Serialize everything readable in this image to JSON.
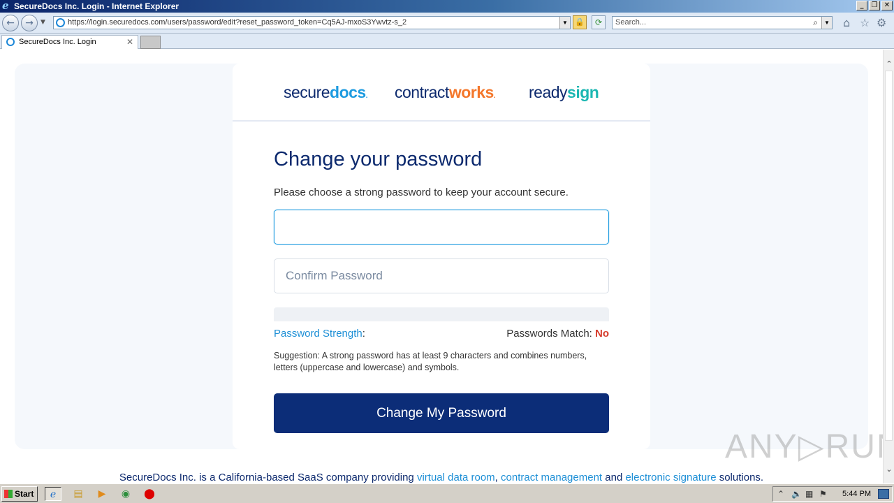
{
  "window": {
    "title": "SecureDocs Inc. Login - Internet Explorer",
    "address_url": "https://login.securedocs.com/users/password/edit?reset_password_token=Cq5AJ-mxoS3Ywvtz-s_2",
    "search_placeholder": "Search...",
    "tab_title": "SecureDocs Inc. Login"
  },
  "brands": {
    "securedocs_a": "secure",
    "securedocs_b": "docs",
    "contractworks_a": "contract",
    "contractworks_b": "works",
    "readysign_a": "ready",
    "readysign_b": "sign",
    "dot": "."
  },
  "form": {
    "heading": "Change your password",
    "subtext": "Please choose a strong password to keep your account secure.",
    "password_value": "",
    "confirm_placeholder": "Confirm Password",
    "strength_label": "Password Strength",
    "strength_colon": ":",
    "match_label": "Passwords Match: ",
    "match_value": "No",
    "suggestion": "Suggestion: A strong password has at least 9 characters and combines numbers, letters (uppercase and lowercase) and symbols.",
    "submit_label": "Change My Password"
  },
  "footer": {
    "prefix": "SecureDocs Inc. is a California-based SaaS company providing ",
    "link1": "virtual data room",
    "sep1": ", ",
    "link2": "contract management",
    "sep2": " and ",
    "link3": "electronic signature",
    "suffix": " solutions."
  },
  "watermark": "ANY▷RUN",
  "taskbar": {
    "start_label": "Start",
    "clock": "5:44 PM"
  },
  "colors": {
    "navy": "#0d2a6e",
    "link_blue": "#1d8fd6",
    "button": "#0c2d78",
    "orange": "#f4772b",
    "teal": "#1cb7b2",
    "error_red": "#d63b2b"
  }
}
